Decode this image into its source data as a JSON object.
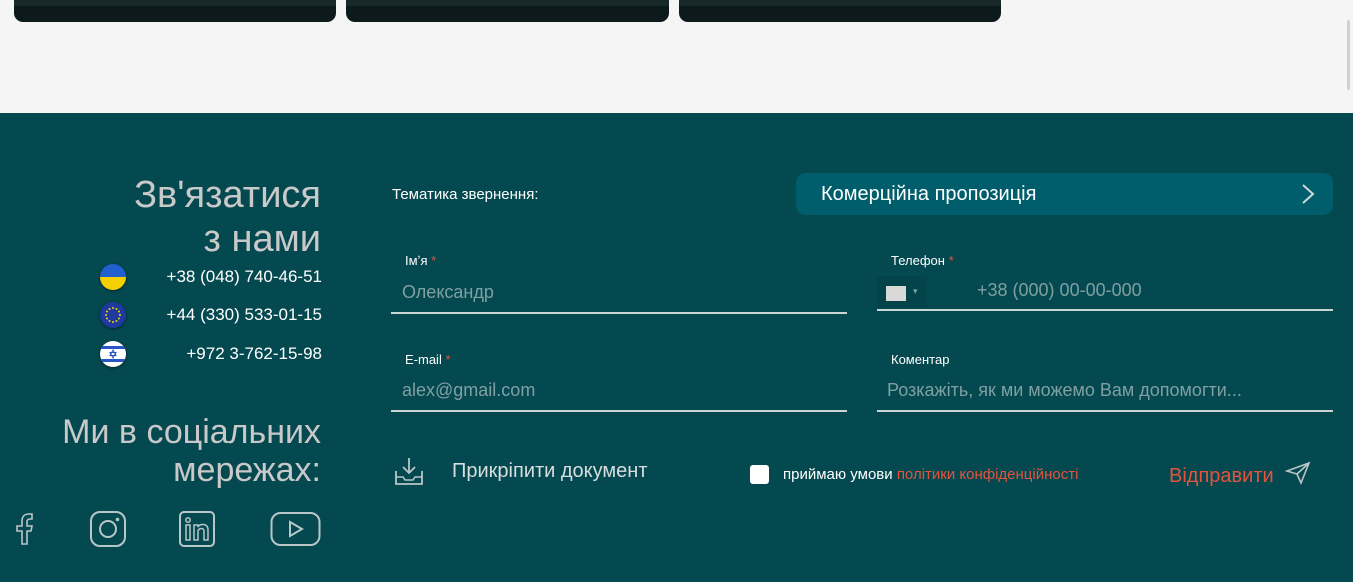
{
  "contact": {
    "title_line1": "Зв'язатися",
    "title_line2": "з нами",
    "phones": [
      {
        "country": "ukraine-flag",
        "number": "+38 (048) 740-46-51"
      },
      {
        "country": "eu-flag",
        "number": "+44 (330) 533-01-15"
      },
      {
        "country": "israel-flag",
        "number": "+972 3-762-15-98"
      }
    ]
  },
  "social": {
    "title_line1": "Ми в соціальних",
    "title_line2": "мережах:",
    "icons": [
      "facebook-icon",
      "instagram-icon",
      "linkedin-icon",
      "youtube-icon"
    ]
  },
  "form": {
    "topic_label": "Тематика звернення:",
    "topic_value": "Комерційна пропозиція",
    "name_label": "Імʼя",
    "name_placeholder": "Олександр",
    "phone_label": "Телефон",
    "phone_placeholder": "+38 (000) 00-00-000",
    "email_label": "E-mail",
    "email_placeholder": "alex@gmail.com",
    "comment_label": "Коментар",
    "comment_placeholder": "Розкажіть, як ми можемо Вам допомогти...",
    "required_mark": "*",
    "attach_label": "Прикріпити документ",
    "consent_text": "приймаю умови",
    "consent_link": "політики конфіденційності",
    "submit_label": "Відправити"
  },
  "colors": {
    "footer_bg": "#044950",
    "accent": "#e5533d",
    "topic_button": "#005e6c",
    "page_bg": "#f5f5f5"
  }
}
